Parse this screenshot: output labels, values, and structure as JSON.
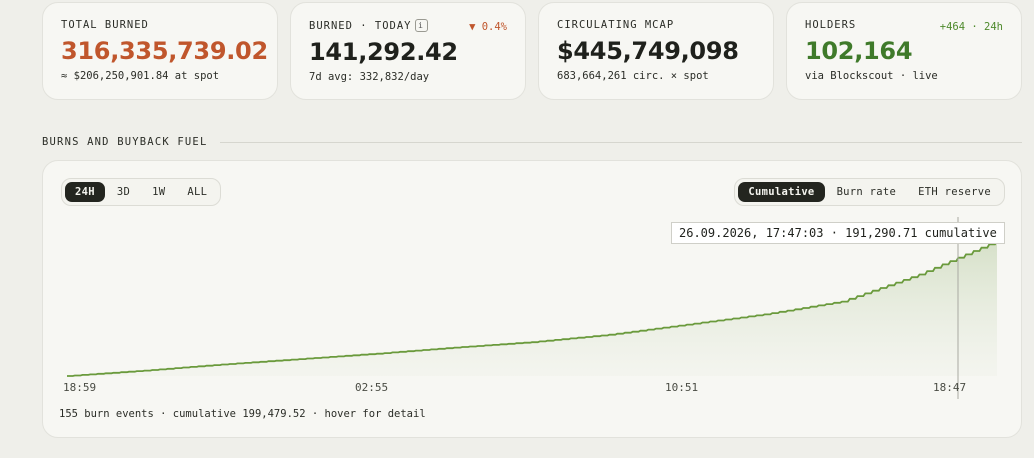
{
  "stats": [
    {
      "label": "TOTAL BURNED",
      "value": "316,335,739.02",
      "sub": "≈ $206,250,901.84 at spot",
      "value_color": "#c0562c"
    },
    {
      "label": "BURNED · TODAY",
      "info": "i",
      "delta": "▼ 0.4%",
      "delta_color": "#c0562c",
      "value": "141,292.42",
      "sub": "7d avg: 332,832/day",
      "value_color": "#1f211c"
    },
    {
      "label": "CIRCULATING MCAP",
      "value": "$445,749,098",
      "sub": "683,664,261 circ. × spot",
      "value_color": "#1f211c"
    },
    {
      "label": "HOLDERS",
      "delta": "+464 · 24h",
      "delta_color": "#4e8a2c",
      "value": "102,164",
      "sub": "via Blockscout · live",
      "value_color": "#3f7a2a"
    }
  ],
  "section": {
    "title": "BURNS AND BUYBACK FUEL"
  },
  "range_tabs": {
    "items": [
      "24H",
      "3D",
      "1W",
      "ALL"
    ],
    "active": "24H"
  },
  "mode_tabs": {
    "items": [
      "Cumulative",
      "Burn rate",
      "ETH reserve"
    ],
    "active": "Cumulative"
  },
  "tooltip": "26.09.2026, 17:47:03 · 191,290.71 cumulative",
  "footer": "155 burn events · cumulative 199,479.52 · hover for detail",
  "chart_data": {
    "type": "area",
    "x_tick_labels": [
      "18:59",
      "02:55",
      "10:51",
      "18:47"
    ],
    "x": [
      0,
      2,
      4,
      6,
      8,
      10,
      12,
      14,
      16,
      18,
      20,
      22,
      24
    ],
    "y": [
      0,
      8,
      17,
      25,
      33,
      42,
      50,
      61,
      76,
      91,
      110,
      150,
      199.48
    ],
    "y_units": "thousand",
    "line_color": "#6a9a3c",
    "fill_color": "#dfe6d3",
    "hover": {
      "time": "26.09.2026, 17:47:03",
      "value": 191290.71
    }
  }
}
